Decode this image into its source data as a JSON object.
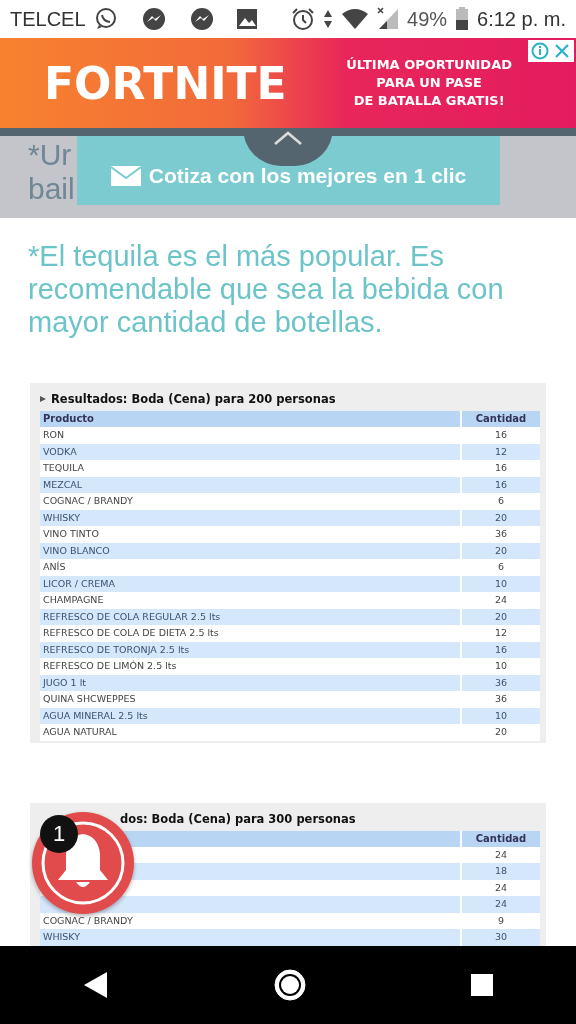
{
  "status_bar": {
    "carrier": "TELCEL",
    "battery": "49%",
    "time": "6:12 p. m."
  },
  "ad": {
    "brand": "FORTNITE",
    "lines": [
      "ÚLTIMA OPORTUNIDAD",
      "PARA UN PASE",
      "DE BATALLA GRATIS!"
    ]
  },
  "background_text": [
    "*Ur",
    "bail"
  ],
  "quote_banner": {
    "label": "Cotiza con los mejores en 1 clic"
  },
  "note": "*El tequila es el más popular. Es recomendable que sea la bebida con mayor cantidad de botellas.",
  "tables": [
    {
      "title": "Resultados: Boda (Cena) para 200 personas",
      "column_headers": {
        "product": "Producto",
        "quantity": "Cantidad"
      },
      "rows": [
        {
          "product": "RON",
          "quantity": "16"
        },
        {
          "product": "VODKA",
          "quantity": "12"
        },
        {
          "product": "TEQUILA",
          "quantity": "16"
        },
        {
          "product": "MEZCAL",
          "quantity": "16"
        },
        {
          "product": "COGNAC / BRANDY",
          "quantity": "6"
        },
        {
          "product": "WHISKY",
          "quantity": "20"
        },
        {
          "product": "VINO TINTO",
          "quantity": "36"
        },
        {
          "product": "VINO BLANCO",
          "quantity": "20"
        },
        {
          "product": "ANÍS",
          "quantity": "6"
        },
        {
          "product": "LICOR / CREMA",
          "quantity": "10"
        },
        {
          "product": "CHAMPAGNE",
          "quantity": "24"
        },
        {
          "product": "REFRESCO DE COLA REGULAR 2.5 lts",
          "quantity": "20"
        },
        {
          "product": "REFRESCO DE COLA DE DIETA 2.5 lts",
          "quantity": "12"
        },
        {
          "product": "REFRESCO DE TORONJA 2.5 lts",
          "quantity": "16"
        },
        {
          "product": "REFRESCO DE LIMÓN 2.5 lts",
          "quantity": "10"
        },
        {
          "product": "JUGO 1 lt",
          "quantity": "36"
        },
        {
          "product": "QUINA SHCWEPPES",
          "quantity": "36"
        },
        {
          "product": "AGUA MINERAL 2.5 lts",
          "quantity": "10"
        },
        {
          "product": "AGUA NATURAL",
          "quantity": "20"
        }
      ]
    },
    {
      "title": "dos: Boda (Cena) para 300 personas",
      "column_headers": {
        "quantity": "Cantidad"
      },
      "rows": [
        {
          "quantity": "24"
        },
        {
          "quantity": "18"
        },
        {
          "quantity": "24"
        },
        {
          "quantity": "24"
        },
        {
          "product": "COGNAC / BRANDY",
          "quantity": "9"
        },
        {
          "product": "WHISKY",
          "quantity": "30"
        }
      ]
    }
  ],
  "notification_button": {
    "badge": "1"
  }
}
